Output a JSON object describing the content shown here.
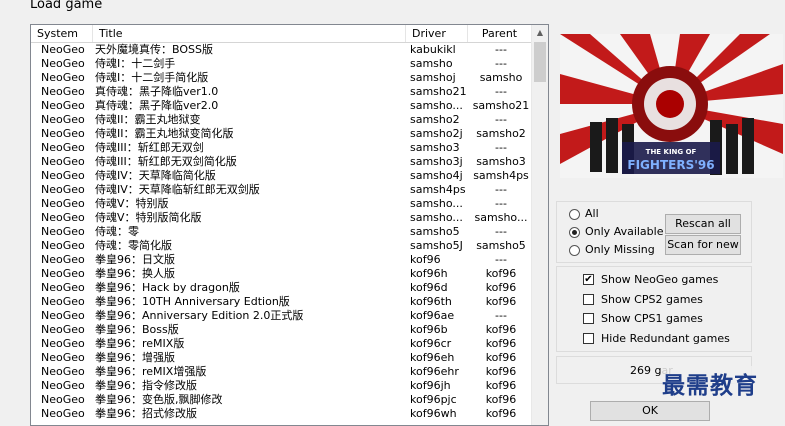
{
  "window": {
    "title": "Load game"
  },
  "columns": {
    "system": "System",
    "title": "Title",
    "driver": "Driver",
    "parent": "Parent"
  },
  "games": [
    {
      "system": "NeoGeo",
      "title": "天外魔境真传：BOSS版",
      "driver": "kabukikl",
      "parent": "---"
    },
    {
      "system": "NeoGeo",
      "title": "侍魂I：十二剑手",
      "driver": "samsho",
      "parent": "---"
    },
    {
      "system": "NeoGeo",
      "title": "侍魂I：十二剑手简化版",
      "driver": "samshoj",
      "parent": "samsho"
    },
    {
      "system": "NeoGeo",
      "title": "真侍魂：黑子降临ver1.0",
      "driver": "samsho21",
      "parent": "---"
    },
    {
      "system": "NeoGeo",
      "title": "真侍魂：黑子降临ver2.0",
      "driver": "samsho...",
      "parent": "samsho21"
    },
    {
      "system": "NeoGeo",
      "title": "侍魂II：霸王丸地狱变",
      "driver": "samsho2",
      "parent": "---"
    },
    {
      "system": "NeoGeo",
      "title": "侍魂II：霸王丸地狱变简化版",
      "driver": "samsho2j",
      "parent": "samsho2"
    },
    {
      "system": "NeoGeo",
      "title": "侍魂III：斩红郎无双剑",
      "driver": "samsho3",
      "parent": "---"
    },
    {
      "system": "NeoGeo",
      "title": "侍魂III：斩红郎无双剑简化版",
      "driver": "samsho3j",
      "parent": "samsho3"
    },
    {
      "system": "NeoGeo",
      "title": "侍魂IV：天草降临简化版",
      "driver": "samsho4j",
      "parent": "samsh4ps"
    },
    {
      "system": "NeoGeo",
      "title": "侍魂IV：天草降临斩红郎无双剑版",
      "driver": "samsh4ps",
      "parent": "---"
    },
    {
      "system": "NeoGeo",
      "title": "侍魂V：特别版",
      "driver": "samsho...",
      "parent": "---"
    },
    {
      "system": "NeoGeo",
      "title": "侍魂V：特别版简化版",
      "driver": "samsho...",
      "parent": "samsho..."
    },
    {
      "system": "NeoGeo",
      "title": "侍魂：零",
      "driver": "samsho5",
      "parent": "---"
    },
    {
      "system": "NeoGeo",
      "title": "侍魂：零简化版",
      "driver": "samsho5J",
      "parent": "samsho5"
    },
    {
      "system": "NeoGeo",
      "title": "拳皇96：日文版",
      "driver": "kof96",
      "parent": "---"
    },
    {
      "system": "NeoGeo",
      "title": "拳皇96：换人版",
      "driver": "kof96h",
      "parent": "kof96"
    },
    {
      "system": "NeoGeo",
      "title": "拳皇96：Hack by dragon版",
      "driver": "kof96d",
      "parent": "kof96"
    },
    {
      "system": "NeoGeo",
      "title": "拳皇96：10TH Anniversary Edtion版",
      "driver": "kof96th",
      "parent": "kof96"
    },
    {
      "system": "NeoGeo",
      "title": "拳皇96：Anniversary Edition 2.0正式版",
      "driver": "kof96ae",
      "parent": "---"
    },
    {
      "system": "NeoGeo",
      "title": "拳皇96：Boss版",
      "driver": "kof96b",
      "parent": "kof96"
    },
    {
      "system": "NeoGeo",
      "title": "拳皇96：reMIX版",
      "driver": "kof96cr",
      "parent": "kof96"
    },
    {
      "system": "NeoGeo",
      "title": "拳皇96：增强版",
      "driver": "kof96eh",
      "parent": "kof96"
    },
    {
      "system": "NeoGeo",
      "title": "拳皇96：reMIX增强版",
      "driver": "kof96ehr",
      "parent": "kof96"
    },
    {
      "system": "NeoGeo",
      "title": "拳皇96：指令修改版",
      "driver": "kof96jh",
      "parent": "kof96"
    },
    {
      "system": "NeoGeo",
      "title": "拳皇96：变色版,飘脚修改",
      "driver": "kof96pjc",
      "parent": "kof96"
    },
    {
      "system": "NeoGeo",
      "title": "拳皇96：招式修改版",
      "driver": "kof96wh",
      "parent": "kof96"
    }
  ],
  "filter": {
    "all": "All",
    "available": "Only Available",
    "missing": "Only Missing",
    "selected": "available"
  },
  "buttons": {
    "rescan": "Rescan all",
    "scan_new": "Scan for new",
    "ok": "OK"
  },
  "options": [
    {
      "label": "Show NeoGeo games",
      "checked": true,
      "mark": "✔"
    },
    {
      "label": "Show CPS2 games",
      "checked": false,
      "mark": ""
    },
    {
      "label": "Show CPS1 games",
      "checked": false,
      "mark": ""
    },
    {
      "label": "Hide Redundant games",
      "checked": false,
      "mark": ""
    }
  ],
  "status": {
    "count_text": "269 gar"
  },
  "watermark": {
    "text": "最需教育"
  },
  "preview": {
    "logo_line1": "THE KING OF",
    "logo_line2": "FIGHTERS'96"
  }
}
